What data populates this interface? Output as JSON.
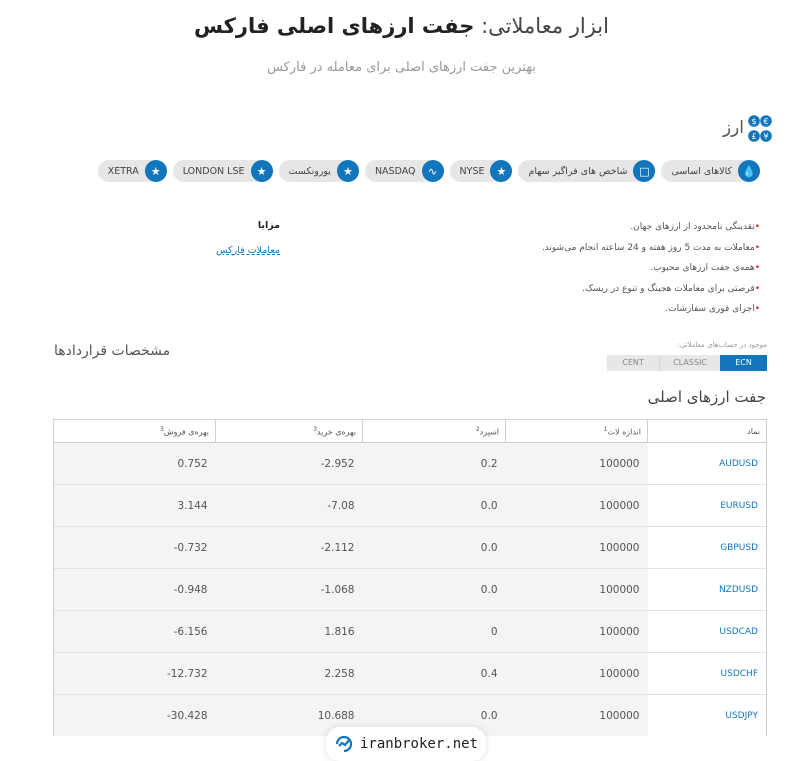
{
  "header": {
    "title_prefix": "ابزار معاملاتی:",
    "title_bold": "جفت ارزهای اصلی فارکس",
    "subtitle": "بهترین جفت ارزهای اصلی برای معامله در فارکس"
  },
  "section": {
    "title": "ارز",
    "icon": "currency-symbols-icon"
  },
  "categories": [
    {
      "label": "کالاهای اساسی",
      "icon": "drop-icon"
    },
    {
      "label": "شاخص های فراگیر سهام",
      "icon": "monitor-icon"
    },
    {
      "label": "NYSE",
      "icon": "star-icon"
    },
    {
      "label": "NASDAQ",
      "icon": "trend-icon"
    },
    {
      "label": "یورونکست",
      "icon": "star-icon"
    },
    {
      "label": "LONDON LSE",
      "icon": "star-icon"
    },
    {
      "label": "XETRA",
      "icon": "star-icon"
    }
  ],
  "features": [
    "•نقدینگی نامحدود از ارزهای جهان.",
    "•معاملات به مدت 5 روز هفته و 24 ساعته انجام می‌شوند.",
    "•همه‌ی جفت ارزهای محبوب.",
    "•فرصتی برای معاملات هجینگ و تنوع در ریسک.",
    "•اجرای فوری سفارشات."
  ],
  "advantages": {
    "title": "مزایا",
    "link": "معاملات فارکس"
  },
  "contract_specs": {
    "title": "مشخصات قراردادها",
    "accounts_label": "موجود در حساب‌های معاملاتی:",
    "tabs": [
      "CENT",
      "CLASSIC",
      "ECN"
    ],
    "active_tab": "ECN"
  },
  "pairs_title": "جفت ارزهای اصلی",
  "table": {
    "headers": {
      "symbol": "نماد",
      "lot": "اندازه لات",
      "spread": "اسپرد",
      "swap_buy": "بهره‌ی خرید",
      "swap_sell": "بهره‌ی فروش"
    },
    "header_marks": {
      "lot": "1",
      "spread": "2",
      "swap_buy": "3",
      "swap_sell": "3"
    },
    "rows": [
      {
        "symbol": "AUDUSD",
        "lot": "100000",
        "spread": "0.2",
        "swap_buy": "-2.952",
        "swap_sell": "0.752"
      },
      {
        "symbol": "EURUSD",
        "lot": "100000",
        "spread": "0.0",
        "swap_buy": "-7.08",
        "swap_sell": "3.144"
      },
      {
        "symbol": "GBPUSD",
        "lot": "100000",
        "spread": "0.0",
        "swap_buy": "-2.112",
        "swap_sell": "-0.732"
      },
      {
        "symbol": "NZDUSD",
        "lot": "100000",
        "spread": "0.0",
        "swap_buy": "-1.068",
        "swap_sell": "-0.948"
      },
      {
        "symbol": "USDCAD",
        "lot": "100000",
        "spread": "0",
        "swap_buy": "1.816",
        "swap_sell": "-6.156"
      },
      {
        "symbol": "USDCHF",
        "lot": "100000",
        "spread": "0.4",
        "swap_buy": "2.258",
        "swap_sell": "-12.732"
      },
      {
        "symbol": "USDJPY",
        "lot": "100000",
        "spread": "0.0",
        "swap_buy": "10.688",
        "swap_sell": "-30.428"
      }
    ]
  },
  "watermark": {
    "text": "iranbroker.net"
  },
  "colors": {
    "accent": "#1276bd",
    "bullet": "#e0271a"
  }
}
